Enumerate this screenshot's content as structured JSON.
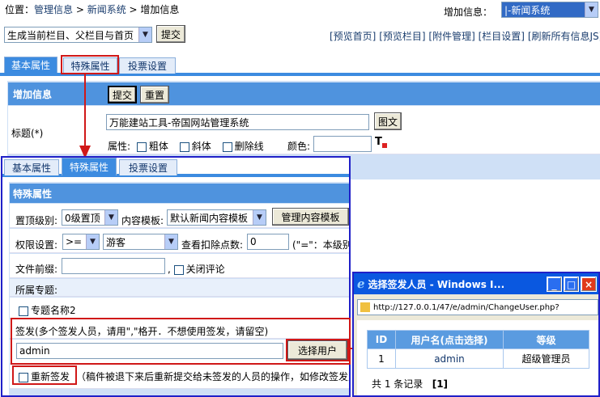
{
  "breadcrumb": {
    "prefix": "位置：",
    "item1": "管理信息",
    "sep1": " > ",
    "item2": "新闻系统",
    "sep2": " > ",
    "item3": "增加信息"
  },
  "top_right": {
    "label": "增加信息：",
    "select_value": "|-新闻系统"
  },
  "toolbar": {
    "refresh_select": "生成当前栏目、父栏目与首页",
    "submit": "提交",
    "links": [
      "[预览首页]",
      "[预览栏目]",
      "[附件管理]",
      "[栏目设置]",
      "[刷新所有信息JS]"
    ]
  },
  "tabs": [
    "基本属性",
    "特殊属性",
    "投票设置"
  ],
  "basic": {
    "section_title": "增加信息",
    "submit": "提交",
    "reset": "重置",
    "title_label": "标题(*)",
    "title_value": "万能建站工具-帝国网站管理系统",
    "pic_button": "图文",
    "attr_label": "属性:",
    "bold": "粗体",
    "italic": "斜体",
    "strike": "删除线",
    "color_label": "颜色:"
  },
  "special": {
    "section_title": "特殊属性",
    "top_level_label": "置顶级别:",
    "top_level_value": "0级置顶",
    "template_label": "内容模板:",
    "template_value": "默认新闻内容模板",
    "manage_template": "管理内容模板",
    "perm_label": "权限设置:",
    "perm_op": ">=",
    "perm_group": "游客",
    "points_label": "查看扣除点数:",
    "points_value": "0",
    "points_hint": "(\"=\"：本级别",
    "prefix_label": "文件前缀:",
    "close_comment": "关闭评论",
    "topic_label": "所属专题:",
    "topic_item": "专题名称2",
    "sign_label": "签发(多个签发人员，请用\",\"格开．不想使用签发，请留空)",
    "sign_value": "admin",
    "choose_user": "选择用户",
    "resign_label": "重新签发",
    "resign_hint": "（稿件被退下来后重新提交给未签发的人员的操作，如修改签发人"
  },
  "popup": {
    "title": "选择签发人员 - Windows I...",
    "url": "http://127.0.0.1/47/e/admin/ChangeUser.php?",
    "columns": [
      "ID",
      "用户名(点击选择)",
      "等级"
    ],
    "rows": [
      {
        "id": "1",
        "user": "admin",
        "level": "超级管理员"
      }
    ],
    "footer_prefix": "共 1 条记录",
    "footer_page": "[1]"
  }
}
